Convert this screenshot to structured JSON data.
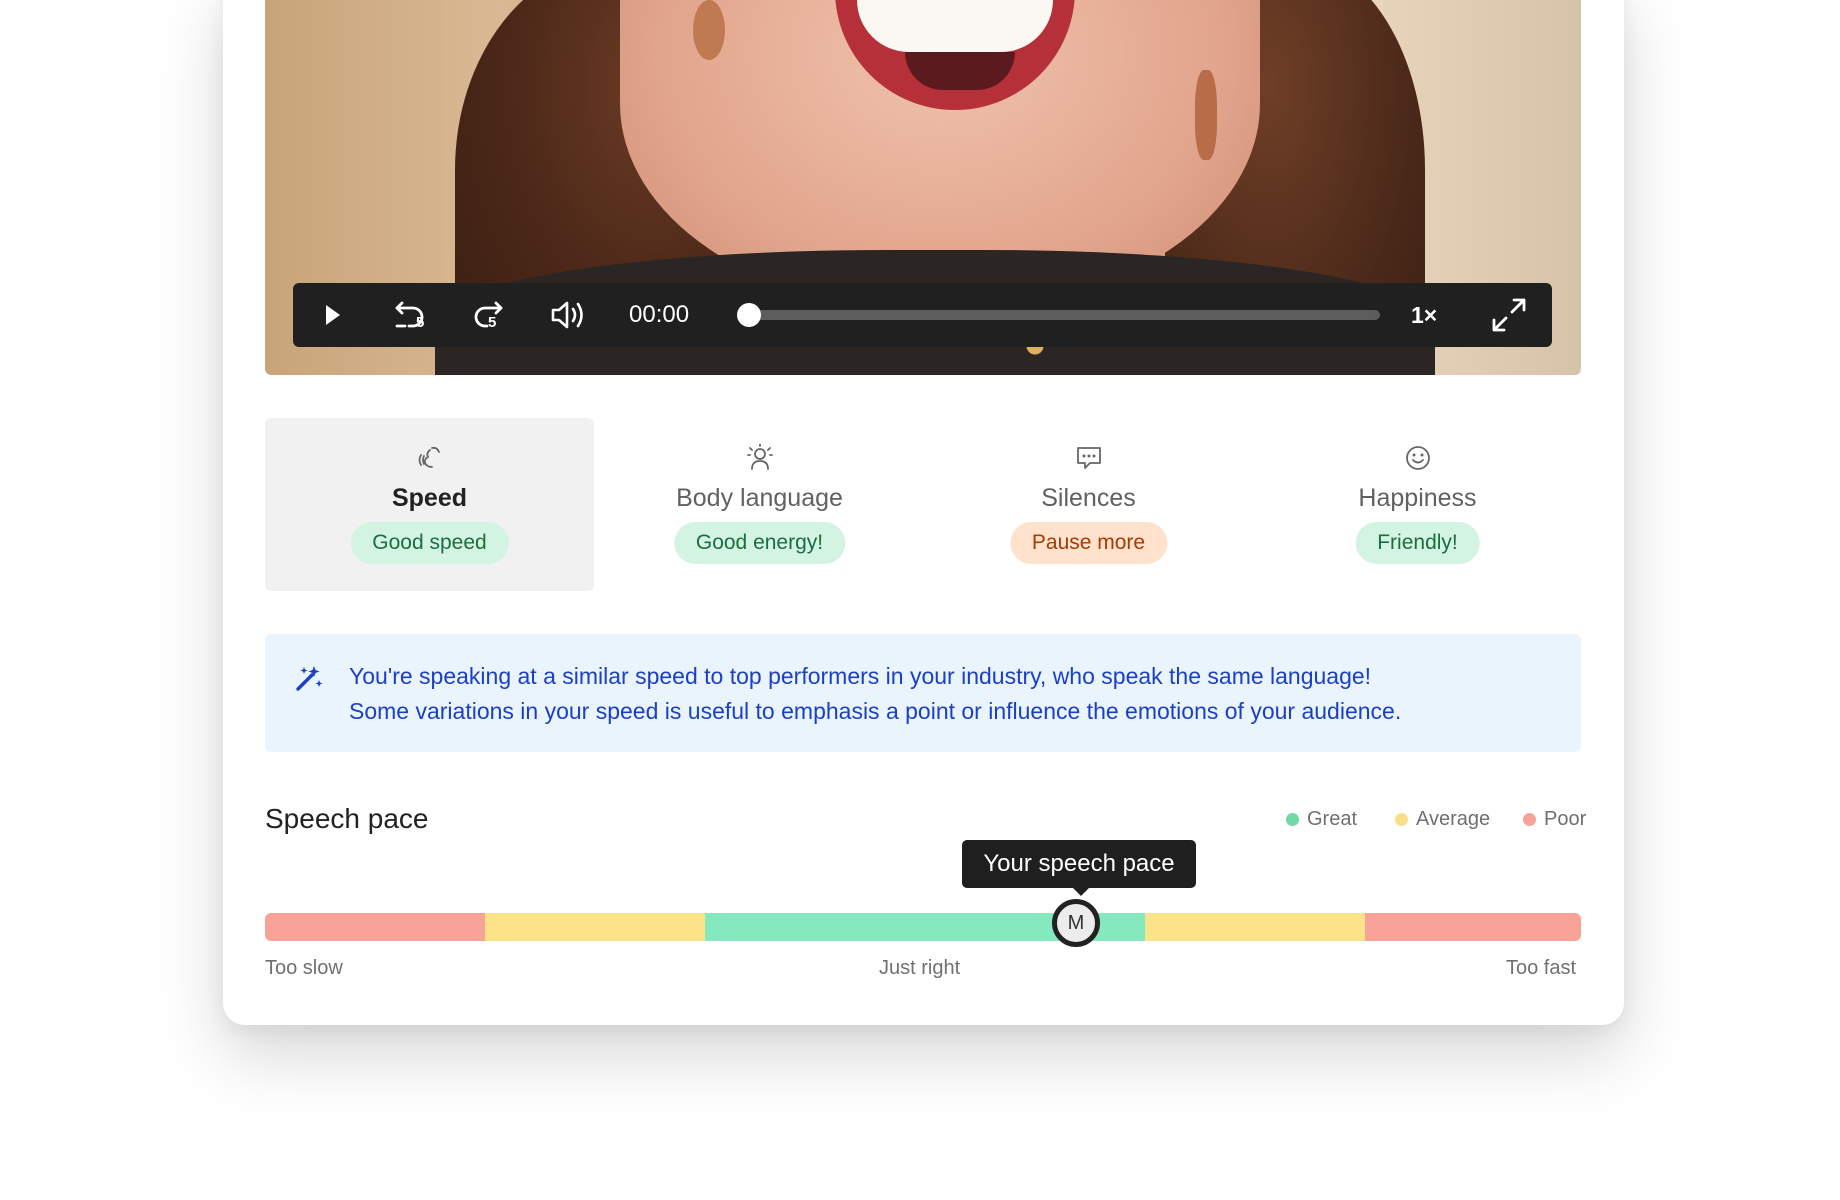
{
  "player": {
    "time": "00:00",
    "progress": 0,
    "playback_rate": "1×",
    "skip_back_seconds": "5",
    "skip_forward_seconds": "5"
  },
  "metrics": [
    {
      "label": "Speed",
      "badge": "Good speed",
      "status": "green",
      "icon": "speech-waves-icon",
      "active": true
    },
    {
      "label": "Body language",
      "badge": "Good energy!",
      "status": "green",
      "icon": "person-radiating-icon",
      "active": false
    },
    {
      "label": "Silences",
      "badge": "Pause more",
      "status": "orange",
      "icon": "chat-bubble-icon",
      "active": false
    },
    {
      "label": "Happiness",
      "badge": "Friendly!",
      "status": "green",
      "icon": "smiley-icon",
      "active": false
    }
  ],
  "insight": {
    "icon": "magic-wand-icon",
    "line1": "You're speaking at a similar speed to top performers in your industry, who speak the same language!",
    "line2": "Some variations in your speed is useful to emphasis a point or influence the emotions of your audience."
  },
  "speech_pace": {
    "title": "Speech pace",
    "legend": [
      {
        "label": "Great",
        "color": "#6fd9a8"
      },
      {
        "label": "Average",
        "color": "#f8e08a"
      },
      {
        "label": "Poor",
        "color": "#f9a298"
      }
    ],
    "segments": [
      "Poor",
      "Average",
      "Great",
      "Great",
      "Average",
      "Poor"
    ],
    "segment_colors": [
      "#f9a298",
      "#fbe38a",
      "#85e8bf",
      "#85e8bf",
      "#fbe38a",
      "#f9a298"
    ],
    "tooltip": "Your speech pace",
    "marker_initial": "M",
    "marker_position": 0.62,
    "scale": {
      "left": "Too slow",
      "center": "Just right",
      "right": "Too fast"
    }
  }
}
